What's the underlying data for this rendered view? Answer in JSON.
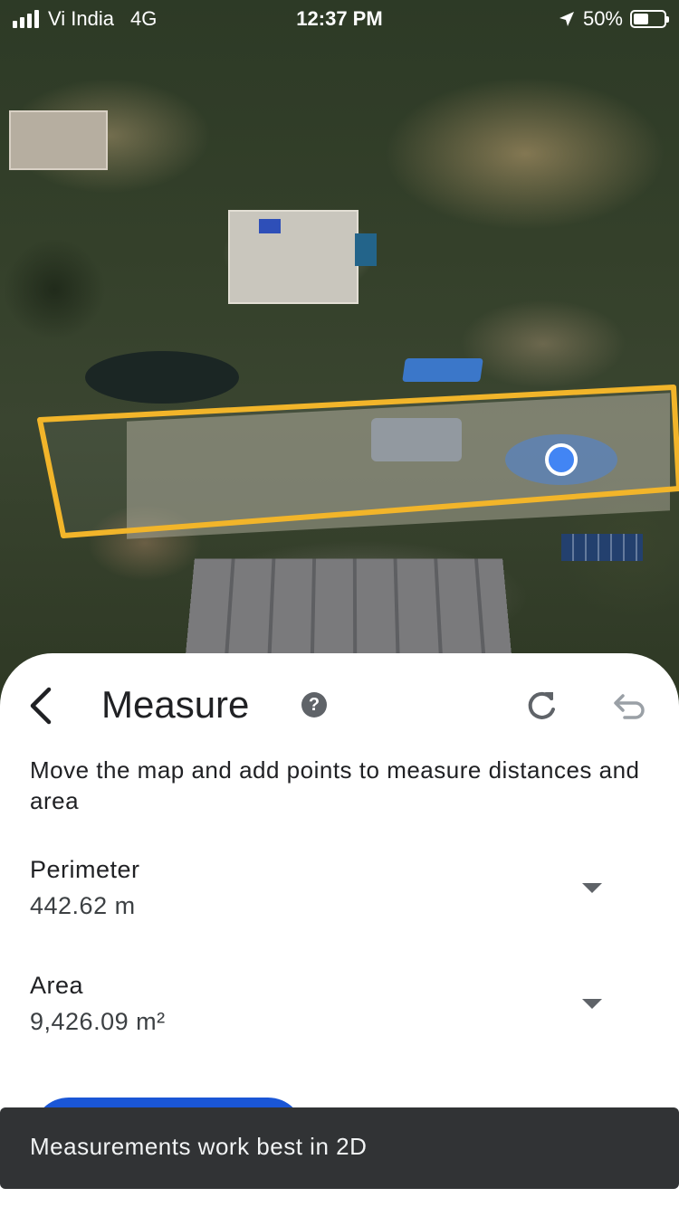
{
  "status_bar": {
    "carrier": "Vi India",
    "network": "4G",
    "time": "12:37 PM",
    "battery_percent": "50%",
    "battery_level": 0.5
  },
  "map": {
    "view_mode": "3D satellite",
    "measurement_outline_color": "#f2b52a",
    "location_dot_color": "#4285f4"
  },
  "sheet": {
    "title": "Measure",
    "help_icon": "question-circle-icon",
    "redo_icon": "refresh-icon",
    "undo_icon": "undo-icon",
    "instructions": "Move the map and add points to measure distances and area",
    "perimeter": {
      "label": "Perimeter",
      "value": "442.62 m"
    },
    "area": {
      "label": "Area",
      "value": "9,426.09 m²"
    },
    "accent_color": "#1a56d6"
  },
  "snackbar": {
    "message": "Measurements work best in 2D"
  }
}
